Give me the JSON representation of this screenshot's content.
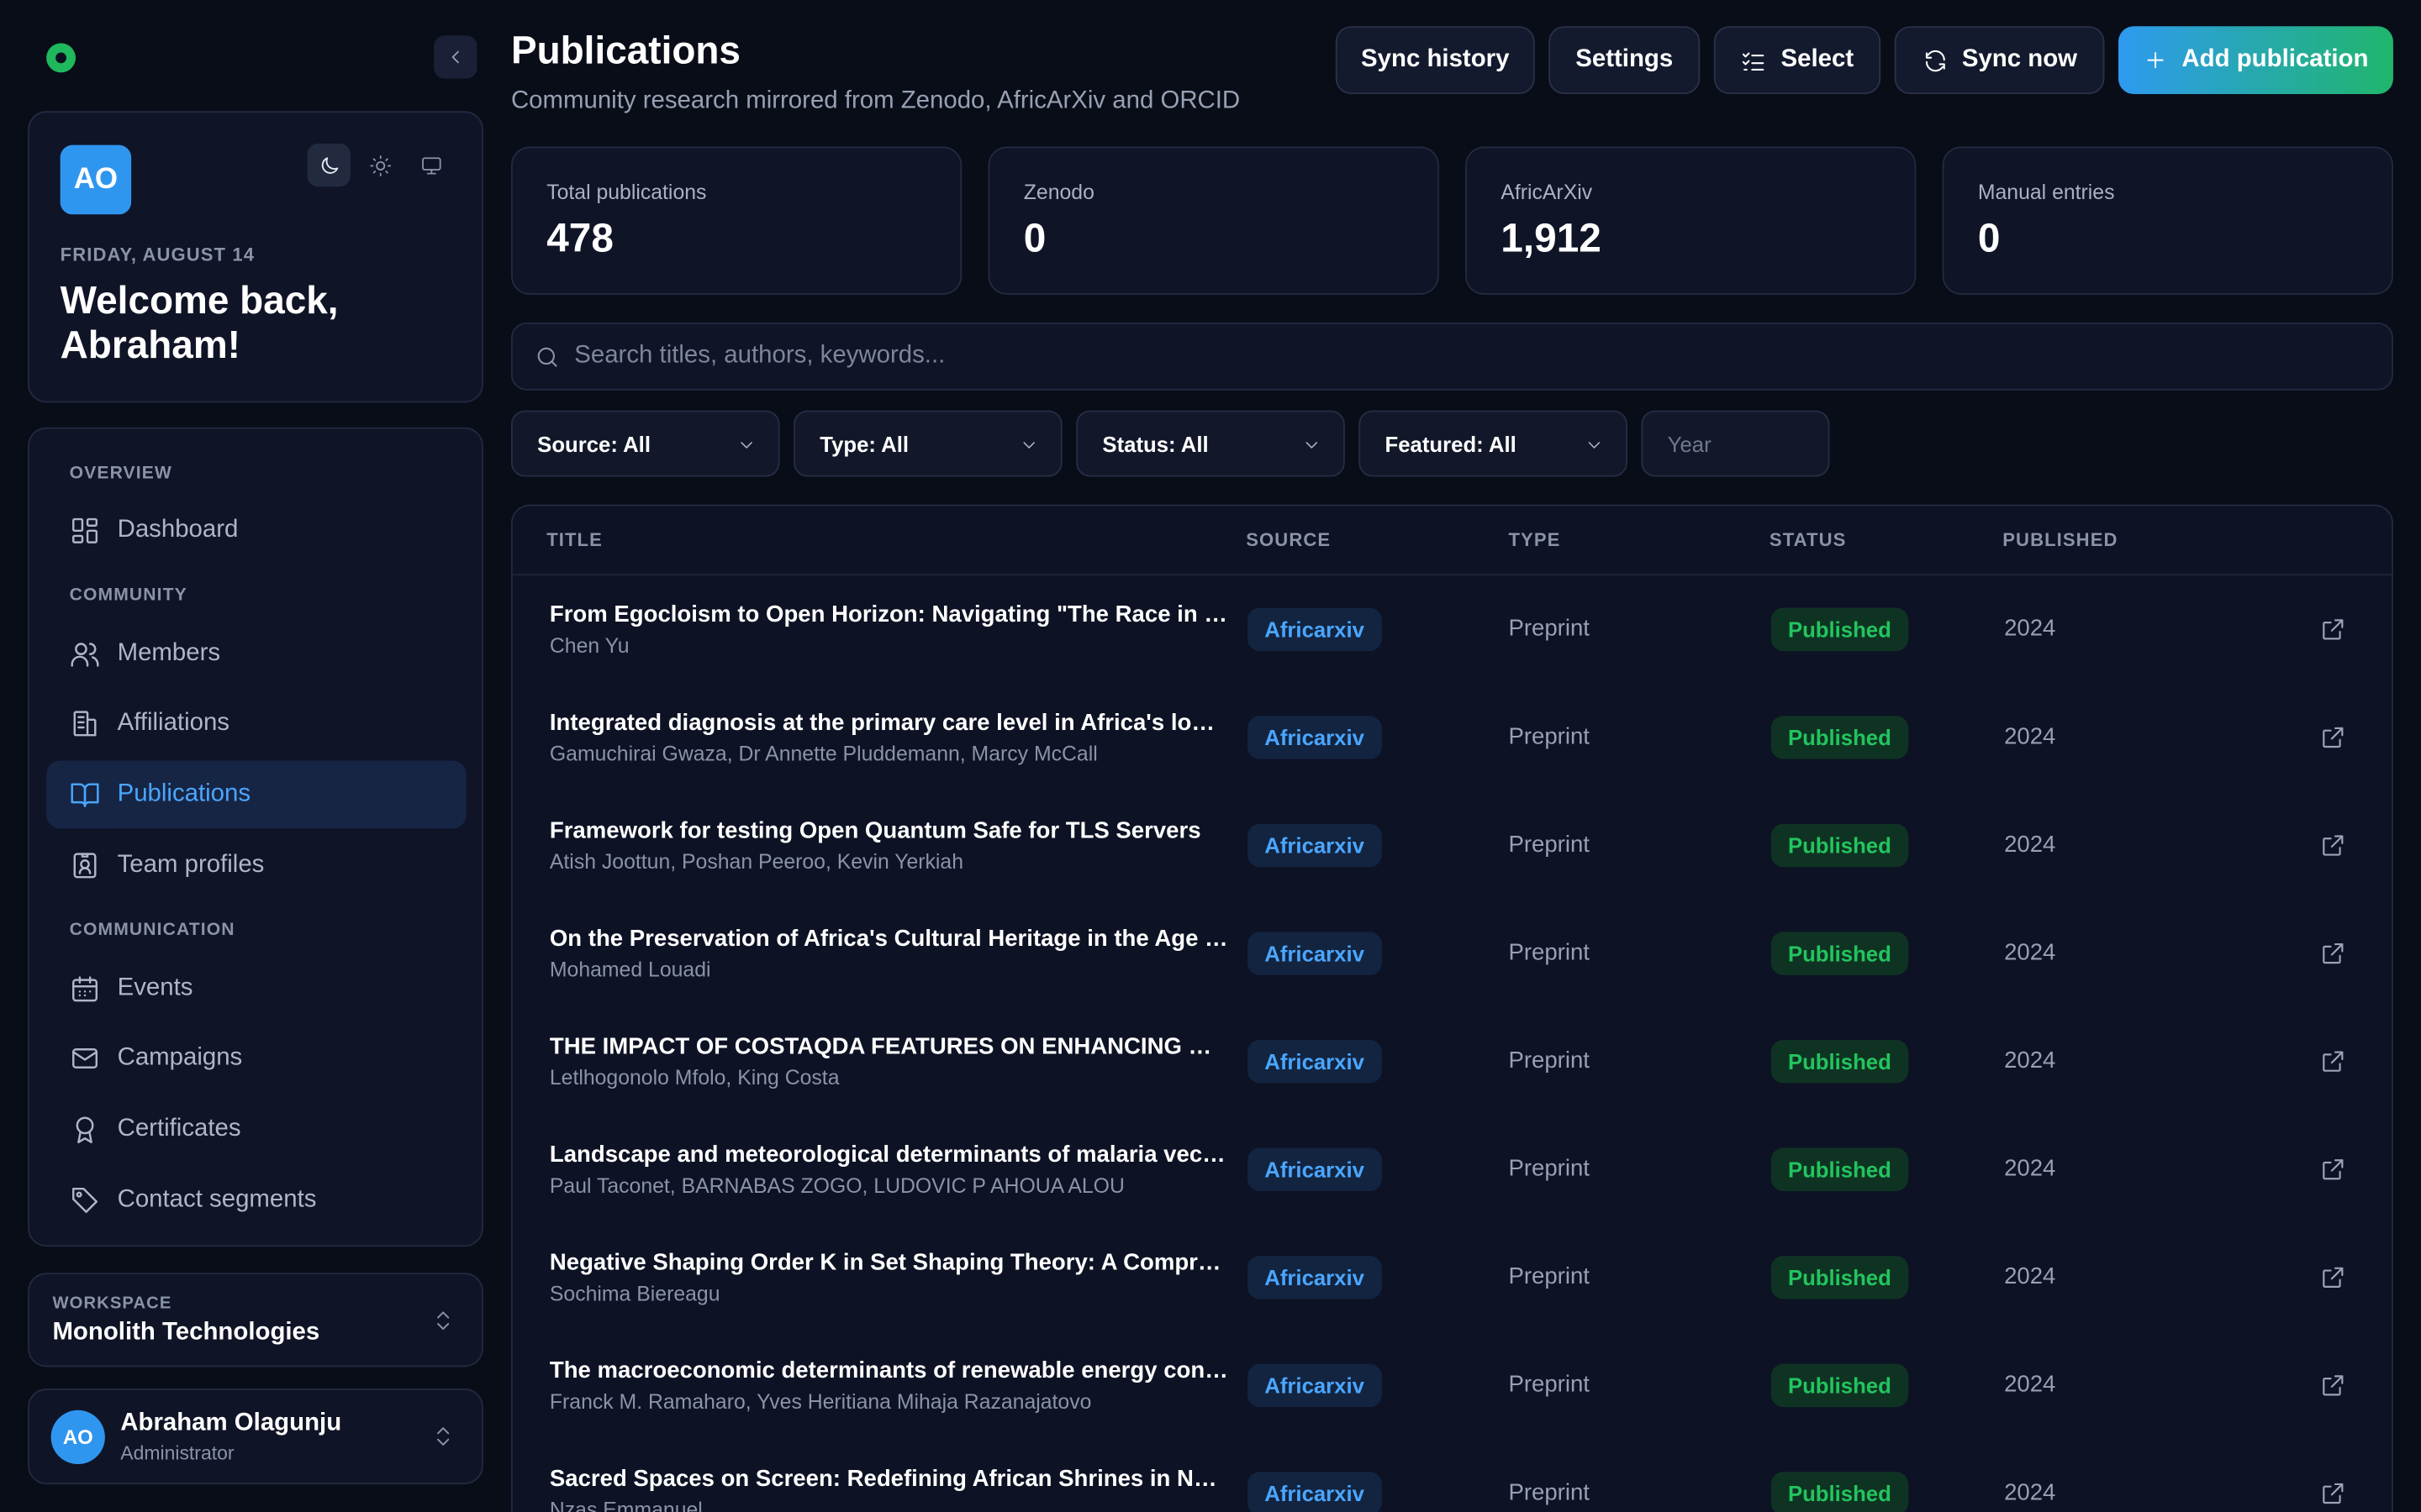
{
  "sidebar": {
    "user_initials": "AO",
    "date": "FRIDAY, AUGUST 14",
    "welcome": "Welcome back, Abraham!",
    "sections": {
      "overview": "OVERVIEW",
      "community": "COMMUNITY",
      "communication": "COMMUNICATION"
    },
    "items": {
      "dashboard": "Dashboard",
      "members": "Members",
      "affiliations": "Affiliations",
      "publications": "Publications",
      "team_profiles": "Team profiles",
      "events": "Events",
      "campaigns": "Campaigns",
      "certificates": "Certificates",
      "contact_segments": "Contact segments"
    },
    "workspace": {
      "label": "WORKSPACE",
      "name": "Monolith Technologies"
    },
    "user": {
      "initials": "AO",
      "name": "Abraham Olagunju",
      "role": "Administrator"
    }
  },
  "header": {
    "title": "Publications",
    "subtitle": "Community research mirrored from Zenodo, AfricArXiv and ORCID",
    "buttons": {
      "sync_history": "Sync history",
      "settings": "Settings",
      "select": "Select",
      "sync_now": "Sync now",
      "add": "Add publication"
    }
  },
  "stats": [
    {
      "label": "Total publications",
      "value": "478"
    },
    {
      "label": "Zenodo",
      "value": "0"
    },
    {
      "label": "AfricArXiv",
      "value": "1,912"
    },
    {
      "label": "Manual entries",
      "value": "0"
    }
  ],
  "search": {
    "placeholder": "Search titles, authors, keywords..."
  },
  "filters": {
    "source": "Source: All",
    "type": "Type: All",
    "status": "Status: All",
    "featured": "Featured: All",
    "year_placeholder": "Year"
  },
  "table": {
    "headers": {
      "title": "TITLE",
      "source": "SOURCE",
      "type": "TYPE",
      "status": "STATUS",
      "published": "PUBLISHED"
    },
    "rows": [
      {
        "title": "From Egocloism to Open Horizon: Navigating \"The Race in a Post-Truth World\"",
        "authors": "Chen Yu",
        "source": "Africarxiv",
        "type": "Preprint",
        "status": "Published",
        "year": "2024"
      },
      {
        "title": "Integrated diagnosis at the primary care level in Africa's low-resource settings",
        "authors": "Gamuchirai Gwaza, Dr Annette Pluddemann, Marcy McCall",
        "source": "Africarxiv",
        "type": "Preprint",
        "status": "Published",
        "year": "2024"
      },
      {
        "title": "Framework for testing Open Quantum Safe for TLS Servers",
        "authors": "Atish Joottun, Poshan Peeroo, Kevin Yerkiah",
        "source": "Africarxiv",
        "type": "Preprint",
        "status": "Published",
        "year": "2024"
      },
      {
        "title": "On the Preservation of Africa's Cultural Heritage in the Age of Artificial Intelligence",
        "authors": "Mohamed Louadi",
        "source": "Africarxiv",
        "type": "Preprint",
        "status": "Published",
        "year": "2024"
      },
      {
        "title": "THE IMPACT OF COSTAQDA FEATURES ON ENHANCING QUALITATIVE DATA ANALYSIS",
        "authors": "Letlhogonolo Mfolo, King Costa",
        "source": "Africarxiv",
        "type": "Preprint",
        "status": "Published",
        "year": "2024"
      },
      {
        "title": "Landscape and meteorological determinants of malaria vector distribution",
        "authors": "Paul Taconet, BARNABAS ZOGO, LUDOVIC P AHOUA ALOU",
        "source": "Africarxiv",
        "type": "Preprint",
        "status": "Published",
        "year": "2024"
      },
      {
        "title": "Negative Shaping Order K in Set Shaping Theory: A Comprehensive Analysis",
        "authors": "Sochima Biereagu",
        "source": "Africarxiv",
        "type": "Preprint",
        "status": "Published",
        "year": "2024"
      },
      {
        "title": "The macroeconomic determinants of renewable energy consumption in Madagascar",
        "authors": "Franck M. Ramaharo, Yves Heritiana Mihaja Razanajatovo",
        "source": "Africarxiv",
        "type": "Preprint",
        "status": "Published",
        "year": "2024"
      },
      {
        "title": "Sacred Spaces on Screen: Redefining African Shrines in Nollywood Films",
        "authors": "Nzas Emmanuel",
        "source": "Africarxiv",
        "type": "Preprint",
        "status": "Published",
        "year": "2024"
      }
    ]
  }
}
